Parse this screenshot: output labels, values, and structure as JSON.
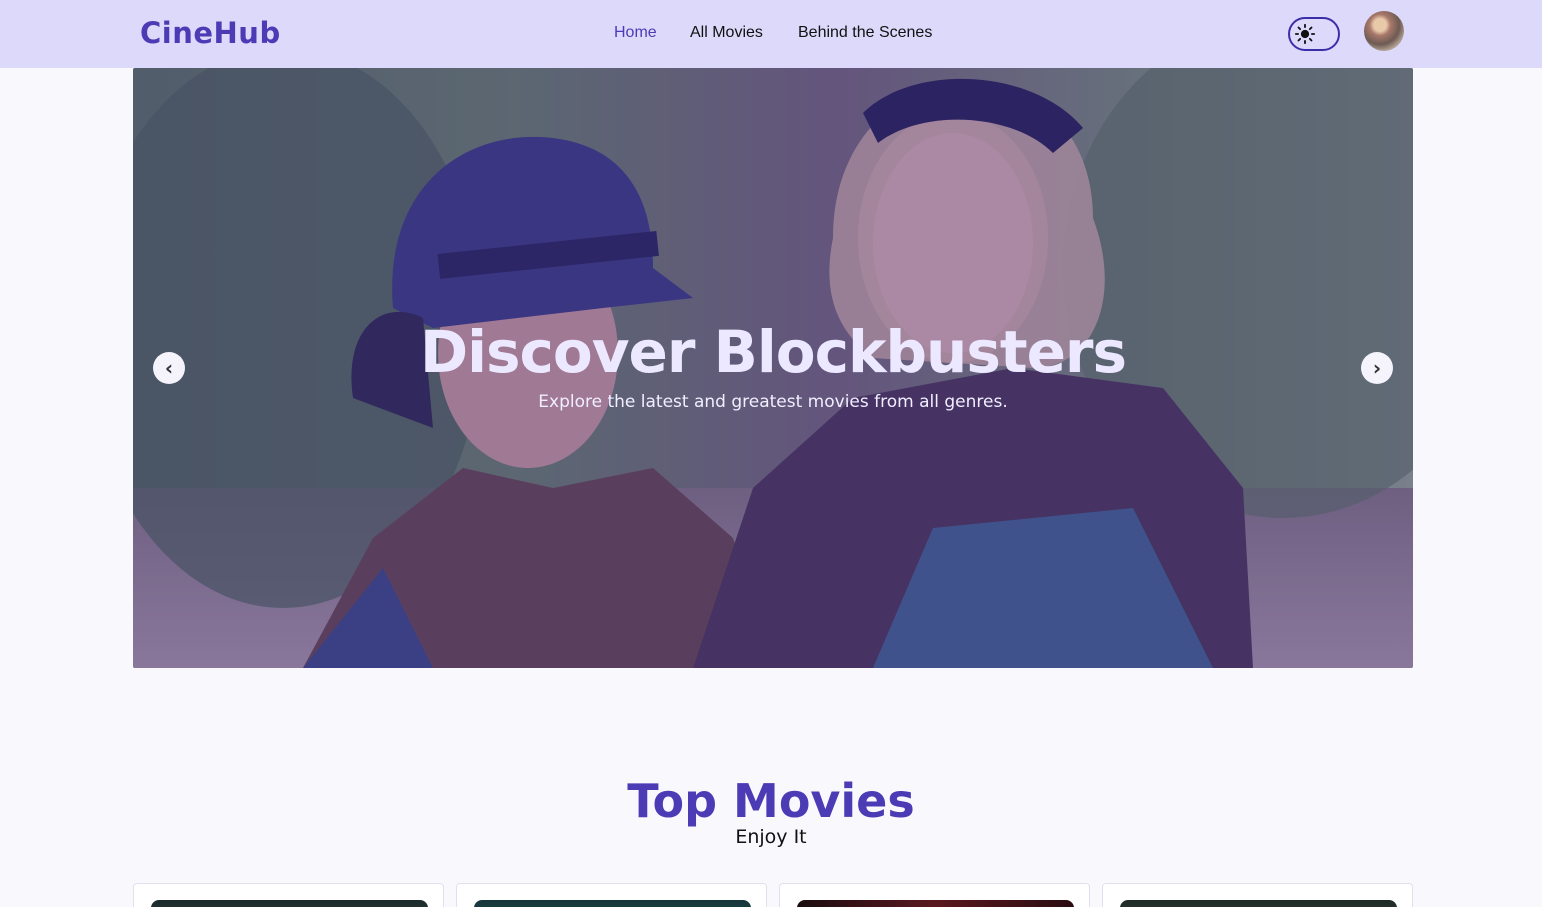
{
  "app": {
    "logo": "CineHub"
  },
  "nav": {
    "links": [
      {
        "label": "Home",
        "active": true
      },
      {
        "label": "All Movies",
        "active": false
      },
      {
        "label": "Behind the Scenes",
        "active": false
      }
    ],
    "theme_icon": "sun-icon",
    "avatar_icon": "user-avatar"
  },
  "hero": {
    "title": "Discover Blockbusters",
    "subtitle": "Explore the latest and greatest movies from all genres.",
    "prev_icon": "chevron-left-icon",
    "prev_glyph": "‹",
    "next_icon": "chevron-right-icon",
    "next_glyph": "›"
  },
  "section": {
    "title": "Top Movies",
    "subtitle": "Enjoy It"
  },
  "colors": {
    "accent": "#4b3bb5",
    "navbar_bg": "#ddd9fb",
    "page_bg": "#f9f9fd"
  }
}
